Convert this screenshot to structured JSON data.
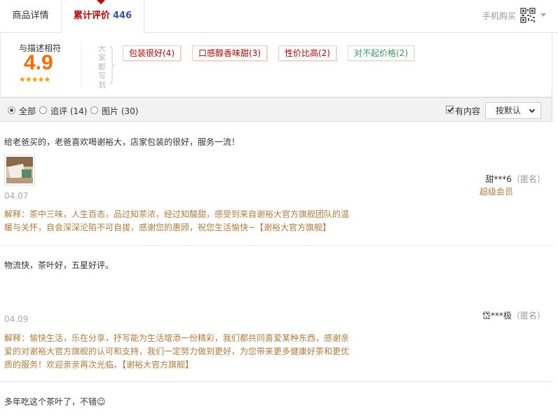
{
  "tabs": {
    "detail_label": "商品详情",
    "reviews_label": "累计评价",
    "reviews_count": "446"
  },
  "header": {
    "mobile_buy": "手机购买",
    "icons": {
      "qr": "qr-code-icon",
      "caret": "caret-down-icon"
    }
  },
  "summary": {
    "score_label": "与描述相符",
    "score": "4.9",
    "stars": "★★★★★",
    "everyone_says": "大家都写到",
    "tags": [
      {
        "label": "包装很好(4)",
        "sentiment": "positive"
      },
      {
        "label": "口感醇香味甜(3)",
        "sentiment": "positive"
      },
      {
        "label": "性价比高(2)",
        "sentiment": "positive"
      },
      {
        "label": "对不起价格(2)",
        "sentiment": "negative"
      }
    ]
  },
  "filters": {
    "all": "全部",
    "append": "追评 (14)",
    "pictures": "图片 (30)",
    "selected": "all",
    "has_content_label": "有内容",
    "has_content_checked": true,
    "sort_label": "按默认"
  },
  "reviews": [
    {
      "text": "给老爸买的，老爸喜欢喝谢裕大，店家包装的很好，服务一流！",
      "date": "04.07",
      "has_photo": true,
      "reply": "解释：茶中三味，人生百态，品过知茶浓，经过知酸甜，感受到来自谢裕大官方旗舰团队的温暖与关怀，自会深深沦陷不可自拔，感谢您的惠顾，祝您生活愉快~【谢裕大官方旗舰】",
      "user": "甜***6",
      "anon": "（匿名）",
      "level": "超级会员"
    },
    {
      "text": "物流快，茶叶好，五星好评。",
      "date": "04.09",
      "has_photo": false,
      "reply": "解释：愉快生活，乐在分享，抒写能为生活增添一份精彩，我们都共同喜爱某种东西，感谢亲爱的对谢裕大官方旗舰的认可和支持，我们一定努力做到更好，为您带来更多健康好茶和更优质的服务！欢迎亲亲再次光临。【谢裕大官方旗舰】",
      "user": "岱***极",
      "anon": "（匿名）",
      "level": ""
    },
    {
      "text": "多年吃这个茶叶了，不错☺"
    }
  ],
  "colors": {
    "brand_red": "#c40000",
    "score_orange": "#ff6a00",
    "reply_brown": "#b07c3b",
    "count_blue": "#3355aa"
  }
}
